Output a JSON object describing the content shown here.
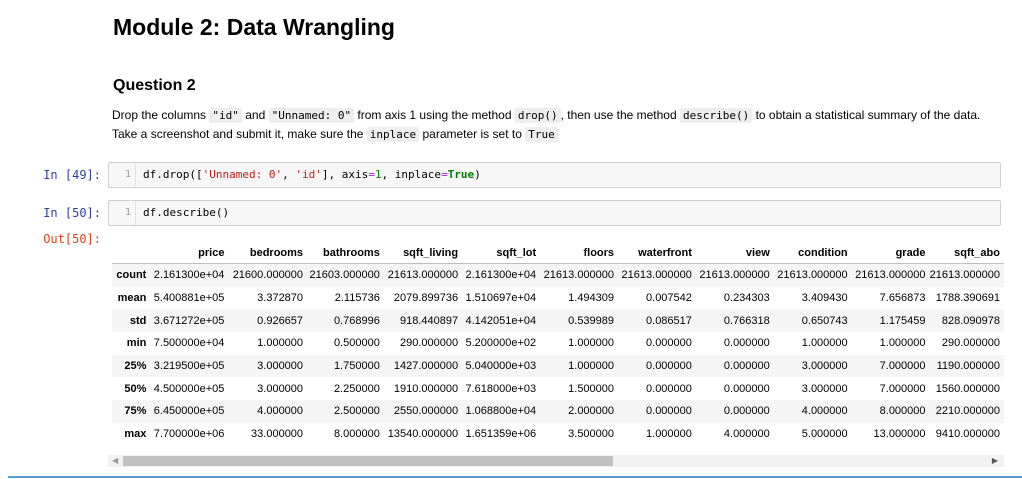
{
  "notebook": {
    "title": "Module 2: Data Wrangling",
    "question_heading": "Question 2",
    "paragraph": {
      "t1": "Drop the columns ",
      "c1": "\"id\"",
      "t2": " and ",
      "c2": "\"Unnamed: 0\"",
      "t3": " from axis 1 using the method ",
      "c3": "drop()",
      "t4": ", then use the method ",
      "c4": "describe()",
      "t5": " to obtain a statistical summary of the data. Take a screenshot and submit it, make sure the ",
      "c5": "inplace",
      "t6": " parameter is set to ",
      "c6": "True"
    },
    "cell1": {
      "prompt": "In [49]:",
      "line_no": "1",
      "code": {
        "a": "df.drop([",
        "s1": "'Unnamed: 0'",
        "b": ", ",
        "s2": "'id'",
        "c": "], axis",
        "eq1": "=",
        "n1": "1",
        "d": ", inplace",
        "eq2": "=",
        "kw": "True",
        "e": ")"
      }
    },
    "cell2": {
      "prompt": "In [50]:",
      "line_no": "1",
      "code": "df.describe()",
      "out_prompt": "Out[50]:"
    }
  },
  "table": {
    "columns": [
      "price",
      "bedrooms",
      "bathrooms",
      "sqft_living",
      "sqft_lot",
      "floors",
      "waterfront",
      "view",
      "condition",
      "grade",
      "sqft_abo"
    ],
    "rows": [
      {
        "label": "count",
        "values": [
          "2.161300e+04",
          "21600.000000",
          "21603.000000",
          "21613.000000",
          "2.161300e+04",
          "21613.000000",
          "21613.000000",
          "21613.000000",
          "21613.000000",
          "21613.000000",
          "21613.000000"
        ]
      },
      {
        "label": "mean",
        "values": [
          "5.400881e+05",
          "3.372870",
          "2.115736",
          "2079.899736",
          "1.510697e+04",
          "1.494309",
          "0.007542",
          "0.234303",
          "3.409430",
          "7.656873",
          "1788.390691"
        ]
      },
      {
        "label": "std",
        "values": [
          "3.671272e+05",
          "0.926657",
          "0.768996",
          "918.440897",
          "4.142051e+04",
          "0.539989",
          "0.086517",
          "0.766318",
          "0.650743",
          "1.175459",
          "828.090978"
        ]
      },
      {
        "label": "min",
        "values": [
          "7.500000e+04",
          "1.000000",
          "0.500000",
          "290.000000",
          "5.200000e+02",
          "1.000000",
          "0.000000",
          "0.000000",
          "1.000000",
          "1.000000",
          "290.000000"
        ]
      },
      {
        "label": "25%",
        "values": [
          "3.219500e+05",
          "3.000000",
          "1.750000",
          "1427.000000",
          "5.040000e+03",
          "1.000000",
          "0.000000",
          "0.000000",
          "3.000000",
          "7.000000",
          "1190.000000"
        ]
      },
      {
        "label": "50%",
        "values": [
          "4.500000e+05",
          "3.000000",
          "2.250000",
          "1910.000000",
          "7.618000e+03",
          "1.500000",
          "0.000000",
          "0.000000",
          "3.000000",
          "7.000000",
          "1560.000000"
        ]
      },
      {
        "label": "75%",
        "values": [
          "6.450000e+05",
          "4.000000",
          "2.500000",
          "2550.000000",
          "1.068800e+04",
          "2.000000",
          "0.000000",
          "0.000000",
          "4.000000",
          "8.000000",
          "2210.000000"
        ]
      },
      {
        "label": "max",
        "values": [
          "7.700000e+06",
          "33.000000",
          "8.000000",
          "13540.000000",
          "1.651359e+06",
          "3.500000",
          "1.000000",
          "4.000000",
          "5.000000",
          "13.000000",
          "9410.000000"
        ]
      }
    ]
  },
  "scrollbar": {
    "left_arrow": "◀",
    "right_arrow": "▶",
    "position_fraction": 0.0
  },
  "colors": {
    "in_prompt": "#303f9f",
    "out_prompt": "#d84315",
    "string": "#ba2121",
    "keyword": "#008000",
    "operator": "#aa22ff"
  }
}
